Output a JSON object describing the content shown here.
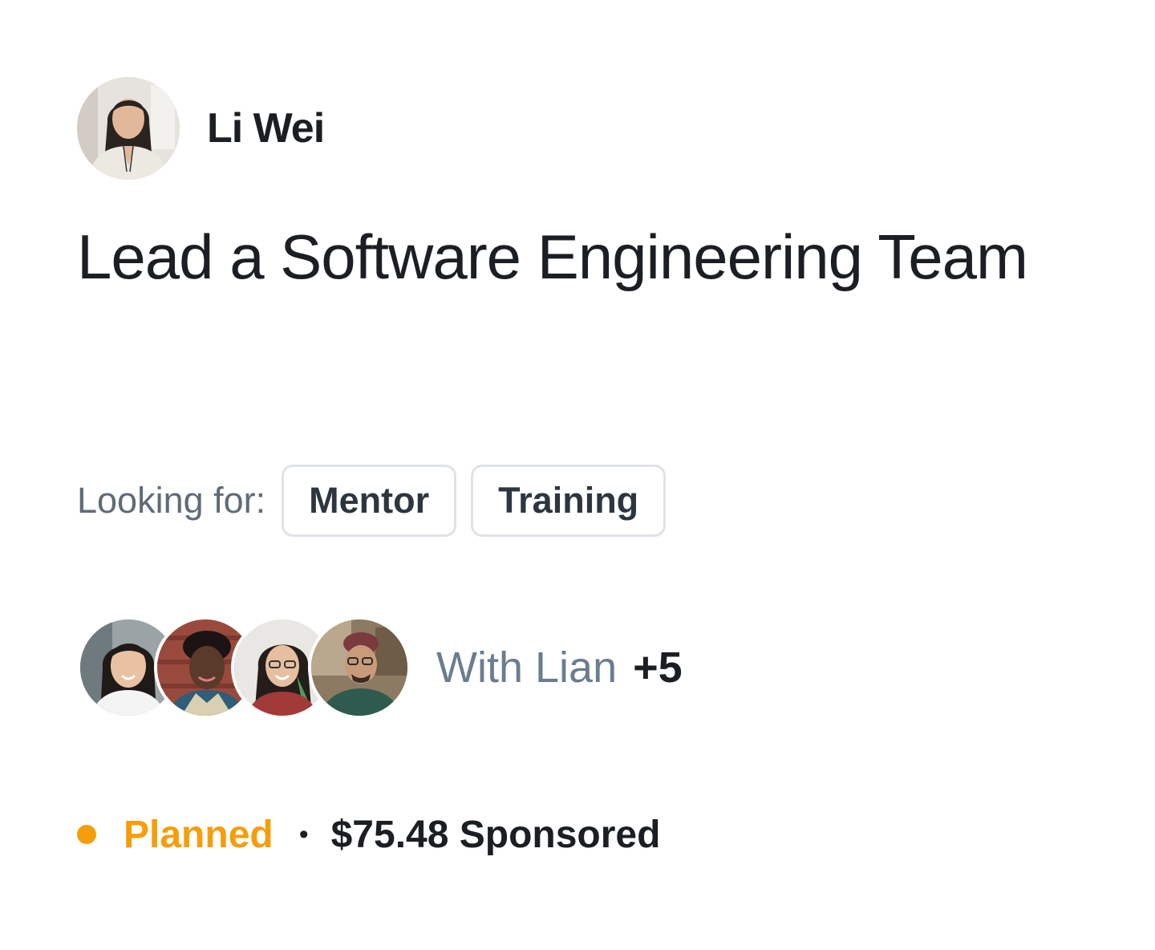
{
  "author": {
    "name": "Li Wei"
  },
  "goal": {
    "title": "Lead a Software Engineering Team"
  },
  "looking_for": {
    "label": "Looking for:",
    "tags": [
      "Mentor",
      "Training"
    ]
  },
  "participants": {
    "with_text": "With Lian",
    "extra_count": "+5"
  },
  "status": {
    "label": "Planned",
    "separator": "•",
    "sponsored": "$75.48 Sponsored",
    "color": "#f59e0b"
  }
}
